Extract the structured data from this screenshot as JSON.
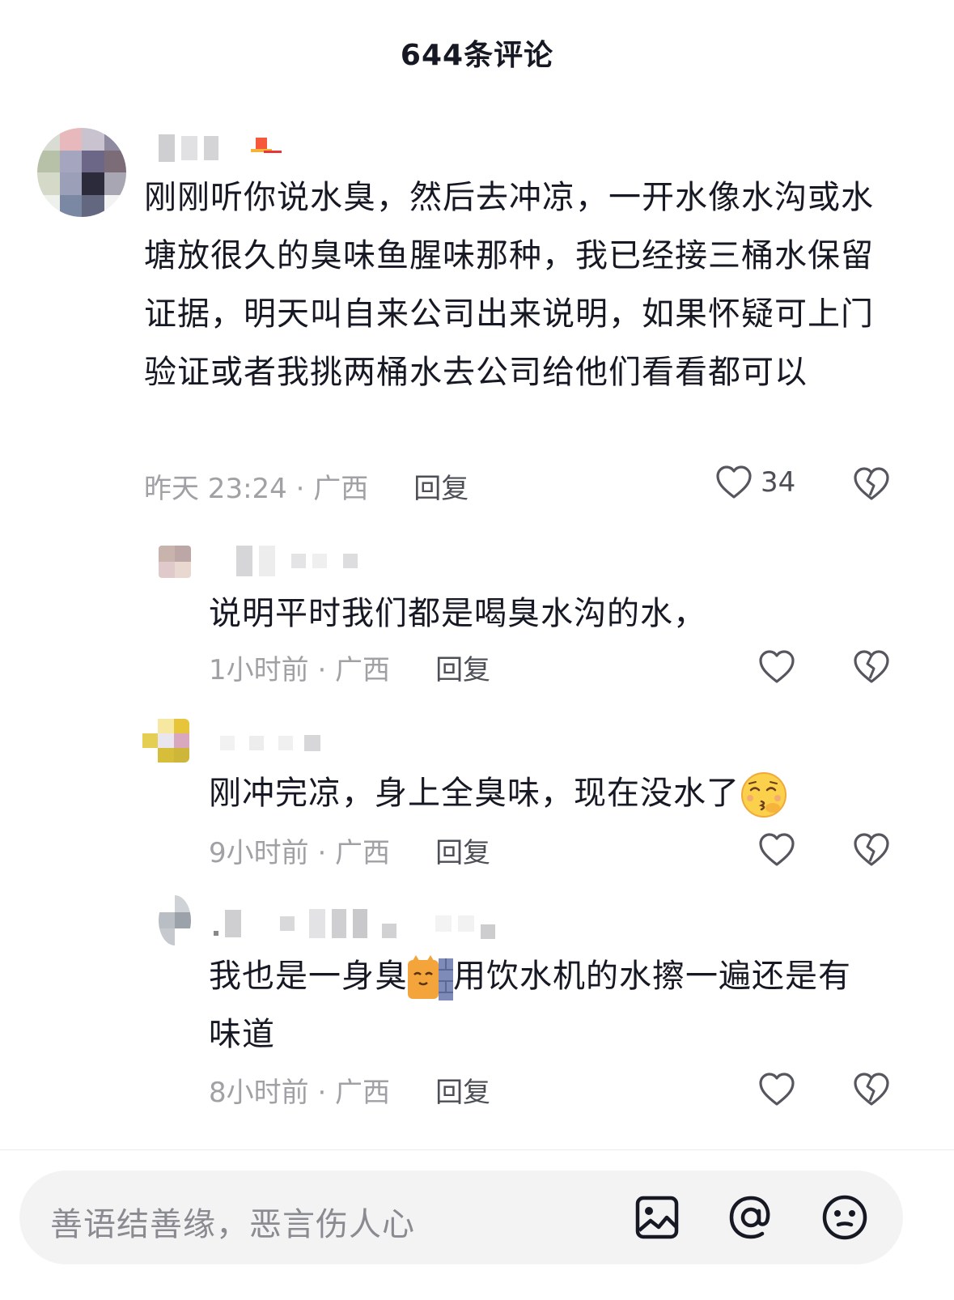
{
  "header": {
    "title": "644条评论"
  },
  "comments": [
    {
      "text": "刚刚听你说水臭，然后去冲凉，一开水像水沟或水塘放很久的臭味鱼腥味那种，我已经接三桶水保留证据，明天叫自来公司出来说明，如果怀疑可上门验证或者我挑两桶水去公司给他们看看都可以",
      "time": "昨天 23:24 · 广西",
      "reply": "回复",
      "likes": "34"
    },
    {
      "text": "说明平时我们都是喝臭水沟的水，",
      "time": "1小时前 · 广西",
      "reply": "回复"
    },
    {
      "text_before_emoji": "刚冲完凉，身上全臭味，现在没水了",
      "emoji": "kissing-face-closed-eyes-emoji",
      "time": "9小时前 · 广西",
      "reply": "回复"
    },
    {
      "text_line1_before_emoji": "我也是一身臭",
      "emoji": "cat-peeking-wall-emoji",
      "text_line1_after_emoji": "用饮水机的水擦一遍还是有",
      "text_line2": "味道",
      "time": "8小时前 · 广西",
      "reply": "回复"
    }
  ],
  "input": {
    "placeholder": "善语结善缘，恶言伤人心",
    "icons": [
      "image-icon",
      "at-mention-icon",
      "emoji-icon"
    ]
  },
  "colors": {
    "text": "#161823",
    "meta": "#a0a0a5",
    "reply": "#4d4f56",
    "input_bg": "#f3f3f4"
  }
}
